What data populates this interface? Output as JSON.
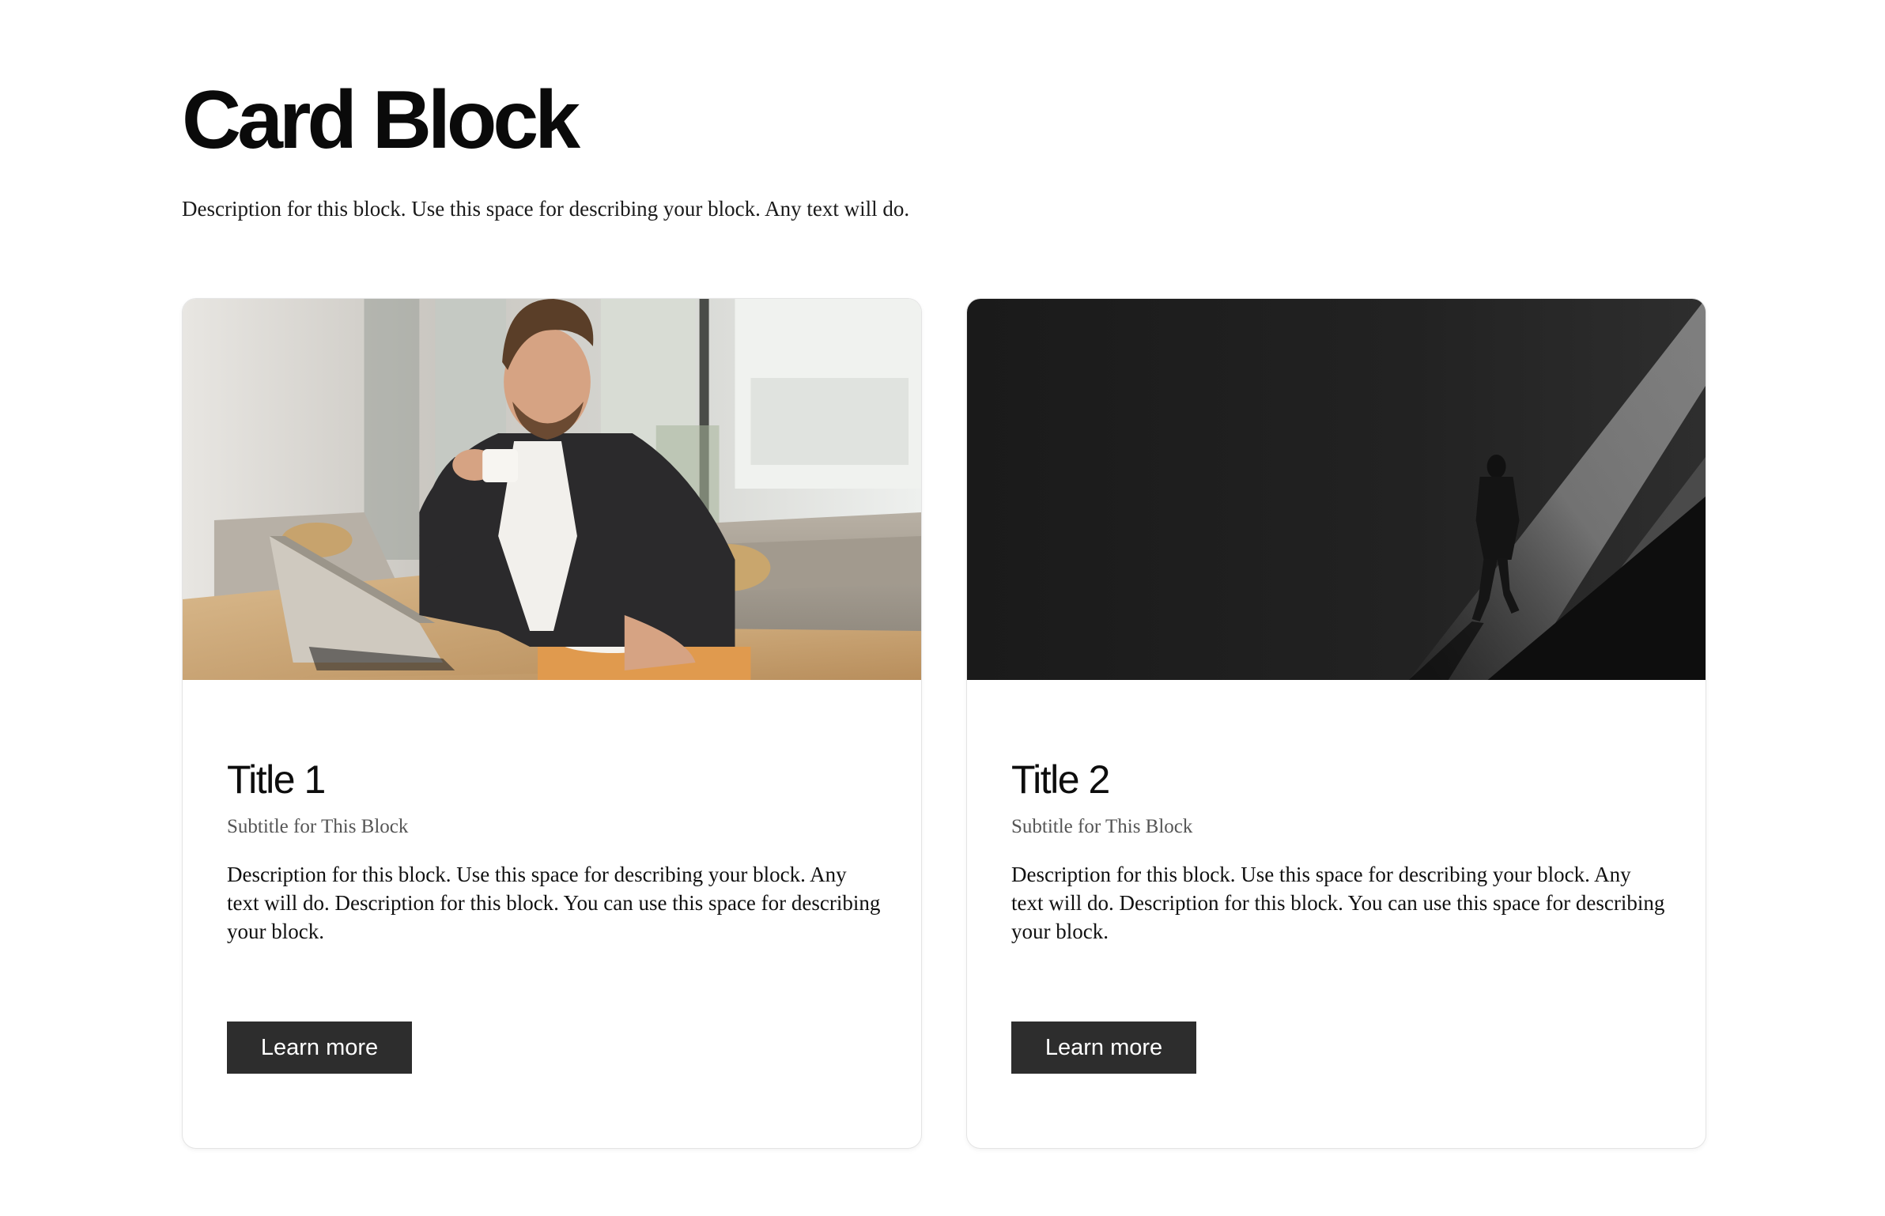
{
  "header": {
    "title": "Card Block",
    "description": "Description for this block. Use this space for describing your block. Any text will do."
  },
  "cards": [
    {
      "image_icon": "photo-man-with-coffee-and-laptop",
      "title": "Title 1",
      "subtitle": "Subtitle for This Block",
      "description": "Description for this block. Use this space for describing your block. Any text will do. Description for this block. You can use this space for describing your block.",
      "button_label": "Learn more"
    },
    {
      "image_icon": "photo-person-walking-in-dark-light-beam",
      "title": "Title 2",
      "subtitle": "Subtitle for This Block",
      "description": "Description for this block. Use this space for describing your block. Any text will do. Description for this block. You can use this space for describing your block.",
      "button_label": "Learn more"
    }
  ],
  "colors": {
    "button_bg": "#2d2d2d",
    "button_text": "#ffffff",
    "card_border": "#e4e4e4",
    "subtitle": "#555555"
  }
}
